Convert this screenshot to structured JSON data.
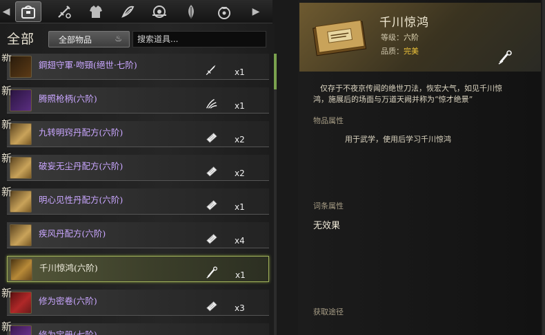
{
  "tabs": [
    {
      "name": "bag-icon"
    },
    {
      "name": "weapon-icon"
    },
    {
      "name": "armor-icon"
    },
    {
      "name": "herb-icon"
    },
    {
      "name": "material-icon"
    },
    {
      "name": "leaf-icon"
    },
    {
      "name": "pouch-icon"
    }
  ],
  "active_tab": 0,
  "filter": {
    "all_label": "全部",
    "dropdown_label": "全部物品",
    "search_placeholder": "搜索道具..."
  },
  "items": [
    {
      "name": "鋼翅守軍·吻頸(絕世·七阶)",
      "qty": "x1",
      "new": true,
      "name_color": "#c9a6ff",
      "thumb": "t-spear",
      "icon": "sword-icon"
    },
    {
      "name": "腾照枪柄(六阶)",
      "qty": "x1",
      "new": true,
      "name_color": "#c9a6ff",
      "thumb": "t-staff",
      "icon": "grass-icon"
    },
    {
      "name": "九转明窍丹配方(六阶)",
      "qty": "x2",
      "new": true,
      "name_color": "#c9a6ff",
      "thumb": "t-recipe",
      "icon": "scroll-icon"
    },
    {
      "name": "破妄无尘丹配方(六阶)",
      "qty": "x2",
      "new": true,
      "name_color": "#c9a6ff",
      "thumb": "t-recipe",
      "icon": "scroll-icon"
    },
    {
      "name": "明心见性丹配方(六阶)",
      "qty": "x1",
      "new": true,
      "name_color": "#c9a6ff",
      "thumb": "t-recipe",
      "icon": "scroll-icon"
    },
    {
      "name": "疾风丹配方(六阶)",
      "qty": "x4",
      "new": false,
      "name_color": "#c9a6ff",
      "thumb": "t-recipe",
      "icon": "scroll-icon"
    },
    {
      "name": "千川惊鸿(六阶)",
      "qty": "x1",
      "new": false,
      "name_color": "#f2efe0",
      "thumb": "t-book",
      "icon": "skill-scroll-icon",
      "selected": true
    },
    {
      "name": "修为密卷(六阶)",
      "qty": "x3",
      "new": true,
      "name_color": "#c9a6ff",
      "thumb": "t-red",
      "icon": "scroll-icon"
    },
    {
      "name": "修为宝册(七阶)",
      "qty": "",
      "new": true,
      "name_color": "#c9a6ff",
      "thumb": "t-purple",
      "icon": "scroll-icon"
    }
  ],
  "detail": {
    "name": "千川惊鸿",
    "level_label": "等级：",
    "level_value": "六阶",
    "quality_label": "品质：",
    "quality_value": "完美",
    "description": "仅存于不夜京传闻的绝世刀法，恢宏大气，如见千川惊鸿，施展后的场面与万道天阙并称为“惊才绝景”",
    "attr_title": "物品属性",
    "attr_body": "用于武学，使用后学习千川惊鸿",
    "entry_title": "词条属性",
    "entry_body": "无效果",
    "source_title": "获取途径"
  },
  "colors": {
    "accent_green": "#9fb05a",
    "quality_gold": "#f0c53a",
    "rare_purple": "#c9a6ff"
  }
}
